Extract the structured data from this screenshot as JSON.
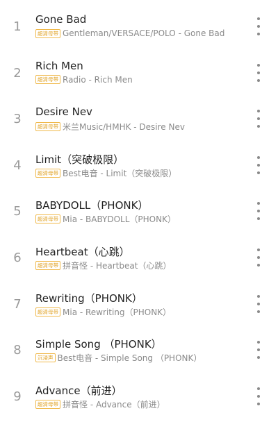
{
  "songs": [
    {
      "index": "1",
      "title": "Gone Bad",
      "badge": "超清母带",
      "meta": "Gentleman/VERSACE/POLO - Gone Bad"
    },
    {
      "index": "2",
      "title": "Rich Men",
      "badge": "超清母带",
      "meta": "Radio - Rich Men"
    },
    {
      "index": "3",
      "title": "Desire Nev",
      "badge": "超清母带",
      "meta": "米兰Music/HMHK - Desire Nev"
    },
    {
      "index": "4",
      "title": "Limit（突破极限）",
      "badge": "超清母带",
      "meta": "Best电音 - Limit（突破极限）"
    },
    {
      "index": "5",
      "title": "BABYDOLL（PHONK）",
      "badge": "超清母带",
      "meta": "Mia - BABYDOLL（PHONK）"
    },
    {
      "index": "6",
      "title": "Heartbeat（心跳）",
      "badge": "超清母带",
      "meta": "拼音怪 - Heartbeat（心跳）"
    },
    {
      "index": "7",
      "title": "Rewriting（PHONK）",
      "badge": "超清母带",
      "meta": "Mia - Rewriting（PHONK）"
    },
    {
      "index": "8",
      "title": "Simple Song （PHONK）",
      "badge": "沉浸声",
      "meta": "Best电音 - Simple Song （PHONK）"
    },
    {
      "index": "9",
      "title": "Advance（前进）",
      "badge": "超清母带",
      "meta": "拼音怪 - Advance（前进）"
    }
  ],
  "icons": {
    "more": "more-vertical-icon"
  },
  "colors": {
    "badge": "#e0a020",
    "title": "#222222",
    "meta": "#8a8a8a",
    "index": "#9a9a9a"
  }
}
